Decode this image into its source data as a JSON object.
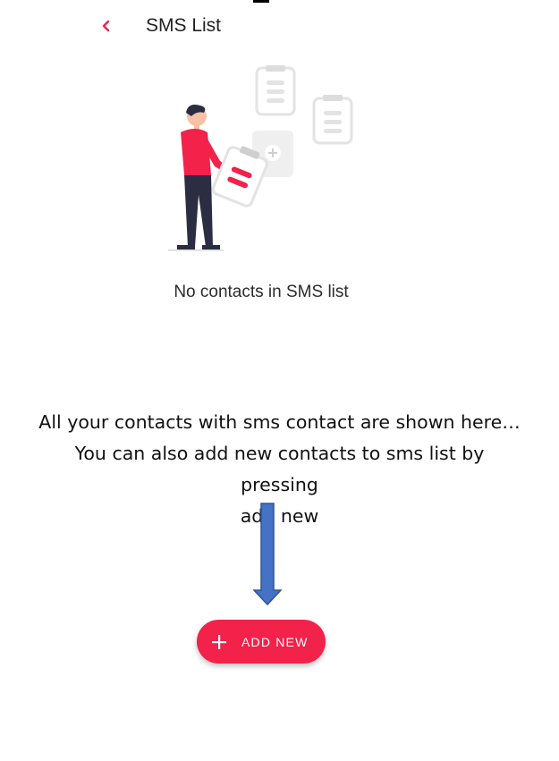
{
  "header": {
    "title": "SMS List",
    "back_icon": "chevron-left-icon"
  },
  "empty_state": {
    "illustration": "person-with-clipboard-illustration",
    "message": "No contacts in SMS list"
  },
  "annotation": {
    "lines": [
      "All your contacts with sms contact are shown here…",
      "You can also add new contacts to sms list by pressing",
      "add new"
    ]
  },
  "fab": {
    "icon": "plus-icon",
    "label": "ADD NEW"
  },
  "colors": {
    "accent": "#f2224a",
    "arrow": "#4472c4"
  }
}
